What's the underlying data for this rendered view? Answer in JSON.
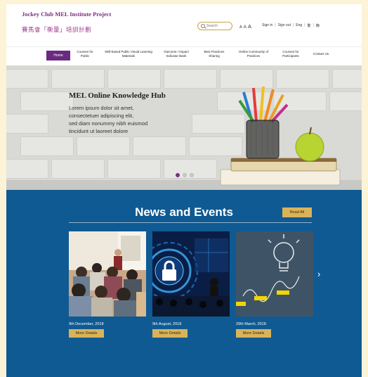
{
  "header": {
    "logo_en": "Jockey Club MEL Institute Project",
    "logo_zh": "賽馬會「衡量」培訓計劃",
    "search_placeholder": "Search",
    "font_sizes": [
      "A",
      "A",
      "A"
    ],
    "sign_in": "Sign in",
    "sign_out": "Sign out",
    "lang_eng": "Eng",
    "lang_tc": "繁",
    "lang_sc": "簡",
    "sep": "|"
  },
  "nav": {
    "items": [
      {
        "label": "Home"
      },
      {
        "label": "Courses for Public"
      },
      {
        "label": "Skill-based Public Visual Learning Materials"
      },
      {
        "label": "Outcome / Impact Indicator Bank"
      },
      {
        "label": "Best Practices Sharing"
      },
      {
        "label": "Online Community of Practices"
      },
      {
        "label": "Courses for Participants"
      },
      {
        "label": "Contact Us"
      }
    ]
  },
  "hero": {
    "title": "MEL Online Knowledge Hub",
    "body_lines": [
      "Lorem ipsum dolor sit amet,",
      "consectetuer adipiscing elit,",
      "sed diam nonummy nibh euismod",
      "tincidunt ut laoreet dolore"
    ],
    "slides": 3,
    "active_slide": 1
  },
  "news": {
    "title": "News and Events",
    "read_all": "Read All",
    "cards": [
      {
        "date": "9th December, 2018",
        "more": "More Details"
      },
      {
        "date": "9th August, 2018",
        "more": "More Details"
      },
      {
        "date": "29th March, 2018",
        "more": "More Details"
      }
    ],
    "next_arrow": "›"
  },
  "colors": {
    "brand_purple": "#7a2e83",
    "news_blue": "#0f5a93",
    "gold": "#d9b35a"
  }
}
